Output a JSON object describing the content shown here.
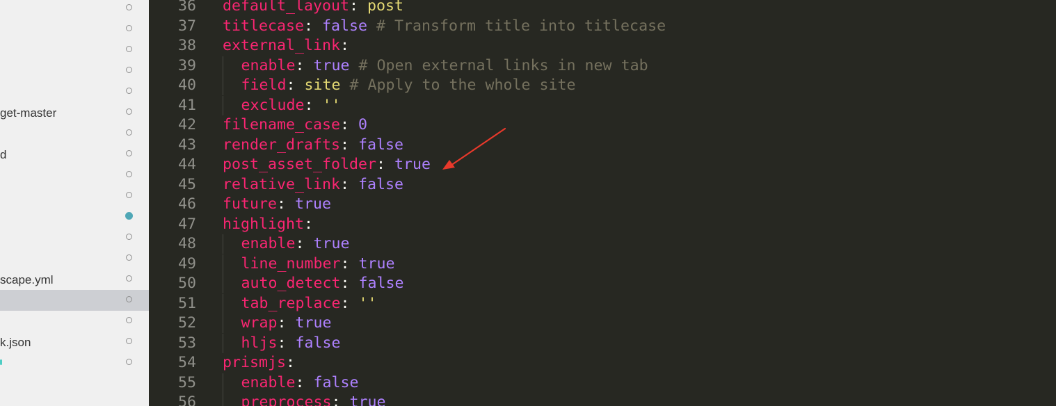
{
  "sidebar": {
    "items": [
      {
        "label": "",
        "status": "hollow",
        "selected": false
      },
      {
        "label": "",
        "status": "hollow",
        "selected": false
      },
      {
        "label": "",
        "status": "hollow",
        "selected": false
      },
      {
        "label": "",
        "status": "hollow",
        "selected": false
      },
      {
        "label": "",
        "status": "hollow",
        "selected": false
      },
      {
        "label": "get-master",
        "status": "hollow",
        "selected": false
      },
      {
        "label": "",
        "status": "hollow",
        "selected": false
      },
      {
        "label": "d",
        "status": "hollow",
        "selected": false
      },
      {
        "label": "",
        "status": "hollow",
        "selected": false
      },
      {
        "label": "",
        "status": "hollow",
        "selected": false
      },
      {
        "label": "",
        "status": "filled",
        "selected": false
      },
      {
        "label": "",
        "status": "hollow",
        "selected": false
      },
      {
        "label": "",
        "status": "hollow",
        "selected": false
      },
      {
        "label": "scape.yml",
        "status": "hollow",
        "selected": false
      },
      {
        "label": "",
        "status": "hollow",
        "selected": true
      },
      {
        "label": "",
        "status": "hollow",
        "selected": false
      },
      {
        "label": "k.json",
        "status": "hollow",
        "selected": false
      },
      {
        "label": "",
        "status": "hollow",
        "selected": false,
        "mark": true
      }
    ]
  },
  "editor": {
    "lines": [
      {
        "num": "36",
        "indent": 0,
        "tokens": [
          {
            "t": "default_layout",
            "c": "k"
          },
          {
            "t": ": ",
            "c": "p"
          },
          {
            "t": "post",
            "c": "s"
          }
        ]
      },
      {
        "num": "37",
        "indent": 0,
        "tokens": [
          {
            "t": "titlecase",
            "c": "k"
          },
          {
            "t": ": ",
            "c": "p"
          },
          {
            "t": "false",
            "c": "b"
          },
          {
            "t": " # Transform title into titlecase",
            "c": "c"
          }
        ]
      },
      {
        "num": "38",
        "indent": 0,
        "tokens": [
          {
            "t": "external_link",
            "c": "k"
          },
          {
            "t": ":",
            "c": "p"
          }
        ]
      },
      {
        "num": "39",
        "indent": 1,
        "tokens": [
          {
            "t": "enable",
            "c": "k"
          },
          {
            "t": ": ",
            "c": "p"
          },
          {
            "t": "true",
            "c": "b"
          },
          {
            "t": " # Open external links in new tab",
            "c": "c"
          }
        ]
      },
      {
        "num": "40",
        "indent": 1,
        "tokens": [
          {
            "t": "field",
            "c": "k"
          },
          {
            "t": ": ",
            "c": "p"
          },
          {
            "t": "site",
            "c": "s"
          },
          {
            "t": " # Apply to the whole site",
            "c": "c"
          }
        ]
      },
      {
        "num": "41",
        "indent": 1,
        "tokens": [
          {
            "t": "exclude",
            "c": "k"
          },
          {
            "t": ": ",
            "c": "p"
          },
          {
            "t": "''",
            "c": "s"
          }
        ]
      },
      {
        "num": "42",
        "indent": 0,
        "tokens": [
          {
            "t": "filename_case",
            "c": "k"
          },
          {
            "t": ": ",
            "c": "p"
          },
          {
            "t": "0",
            "c": "b"
          }
        ]
      },
      {
        "num": "43",
        "indent": 0,
        "tokens": [
          {
            "t": "render_drafts",
            "c": "k"
          },
          {
            "t": ": ",
            "c": "p"
          },
          {
            "t": "false",
            "c": "b"
          }
        ]
      },
      {
        "num": "44",
        "indent": 0,
        "tokens": [
          {
            "t": "post_asset_folder",
            "c": "k"
          },
          {
            "t": ": ",
            "c": "p"
          },
          {
            "t": "true",
            "c": "b"
          }
        ]
      },
      {
        "num": "45",
        "indent": 0,
        "tokens": [
          {
            "t": "relative_link",
            "c": "k"
          },
          {
            "t": ": ",
            "c": "p"
          },
          {
            "t": "false",
            "c": "b"
          }
        ]
      },
      {
        "num": "46",
        "indent": 0,
        "tokens": [
          {
            "t": "future",
            "c": "k"
          },
          {
            "t": ": ",
            "c": "p"
          },
          {
            "t": "true",
            "c": "b"
          }
        ]
      },
      {
        "num": "47",
        "indent": 0,
        "tokens": [
          {
            "t": "highlight",
            "c": "k"
          },
          {
            "t": ":",
            "c": "p"
          }
        ]
      },
      {
        "num": "48",
        "indent": 1,
        "tokens": [
          {
            "t": "enable",
            "c": "k"
          },
          {
            "t": ": ",
            "c": "p"
          },
          {
            "t": "true",
            "c": "b"
          }
        ]
      },
      {
        "num": "49",
        "indent": 1,
        "tokens": [
          {
            "t": "line_number",
            "c": "k"
          },
          {
            "t": ": ",
            "c": "p"
          },
          {
            "t": "true",
            "c": "b"
          }
        ]
      },
      {
        "num": "50",
        "indent": 1,
        "tokens": [
          {
            "t": "auto_detect",
            "c": "k"
          },
          {
            "t": ": ",
            "c": "p"
          },
          {
            "t": "false",
            "c": "b"
          }
        ]
      },
      {
        "num": "51",
        "indent": 1,
        "tokens": [
          {
            "t": "tab_replace",
            "c": "k"
          },
          {
            "t": ": ",
            "c": "p"
          },
          {
            "t": "''",
            "c": "s"
          }
        ]
      },
      {
        "num": "52",
        "indent": 1,
        "tokens": [
          {
            "t": "wrap",
            "c": "k"
          },
          {
            "t": ": ",
            "c": "p"
          },
          {
            "t": "true",
            "c": "b"
          }
        ]
      },
      {
        "num": "53",
        "indent": 1,
        "tokens": [
          {
            "t": "hljs",
            "c": "k"
          },
          {
            "t": ": ",
            "c": "p"
          },
          {
            "t": "false",
            "c": "b"
          }
        ]
      },
      {
        "num": "54",
        "indent": 0,
        "tokens": [
          {
            "t": "prismjs",
            "c": "k"
          },
          {
            "t": ":",
            "c": "p"
          }
        ]
      },
      {
        "num": "55",
        "indent": 1,
        "tokens": [
          {
            "t": "enable",
            "c": "k"
          },
          {
            "t": ": ",
            "c": "p"
          },
          {
            "t": "false",
            "c": "b"
          }
        ]
      },
      {
        "num": "56",
        "indent": 1,
        "tokens": [
          {
            "t": "preprocess",
            "c": "k"
          },
          {
            "t": ": ",
            "c": "p"
          },
          {
            "t": "true",
            "c": "b"
          }
        ]
      }
    ]
  },
  "annotation": {
    "color": "#e8392b",
    "target_line": "44"
  }
}
